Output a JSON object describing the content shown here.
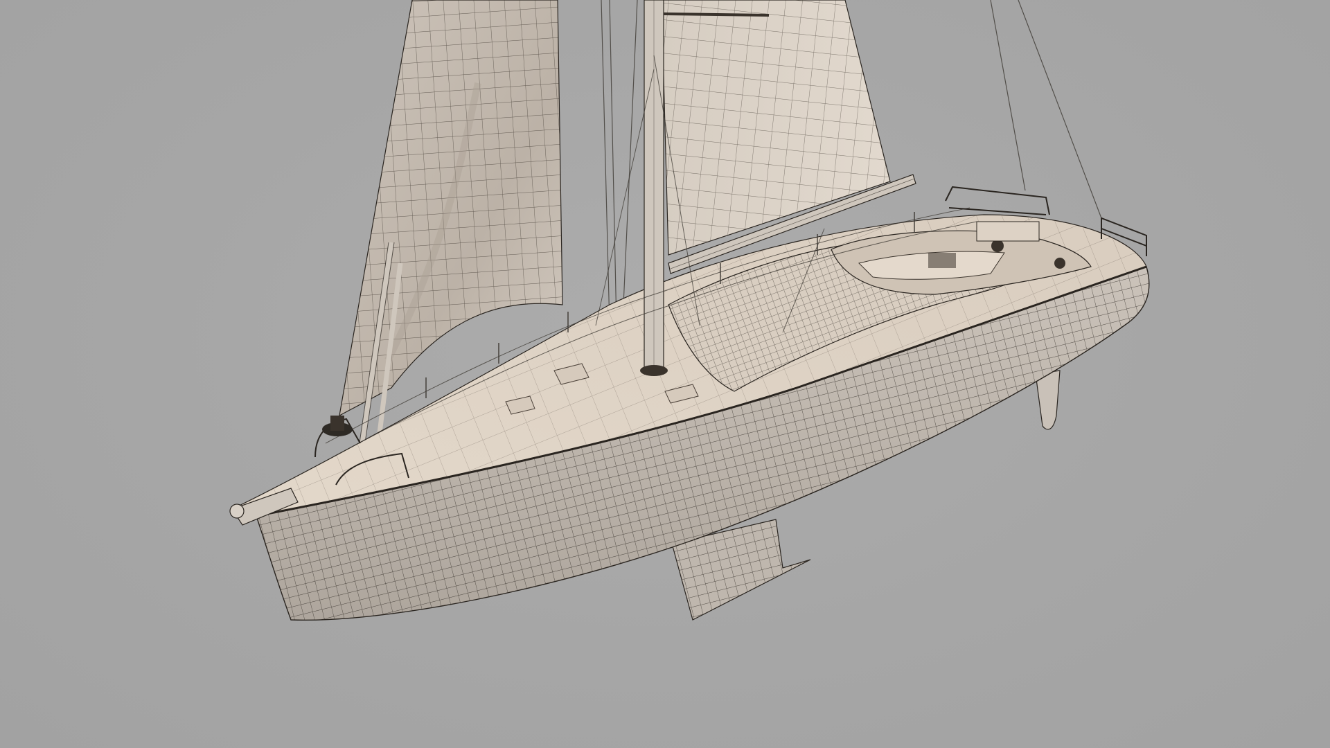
{
  "scene": {
    "subject": "sailboat-wireframe-render",
    "colors": {
      "background": "#a7a7a7",
      "sail": "#d9d0c6",
      "sail_shadow": "#bdb3a8",
      "deck": "#e6dccf",
      "deck_shadow": "#cdbfb0",
      "hull": "#b8b0a7",
      "hull_light": "#cbc3ba",
      "wire": "#2a2520",
      "mast": "#cfc7bd",
      "keel": "#bfb7ae"
    }
  }
}
